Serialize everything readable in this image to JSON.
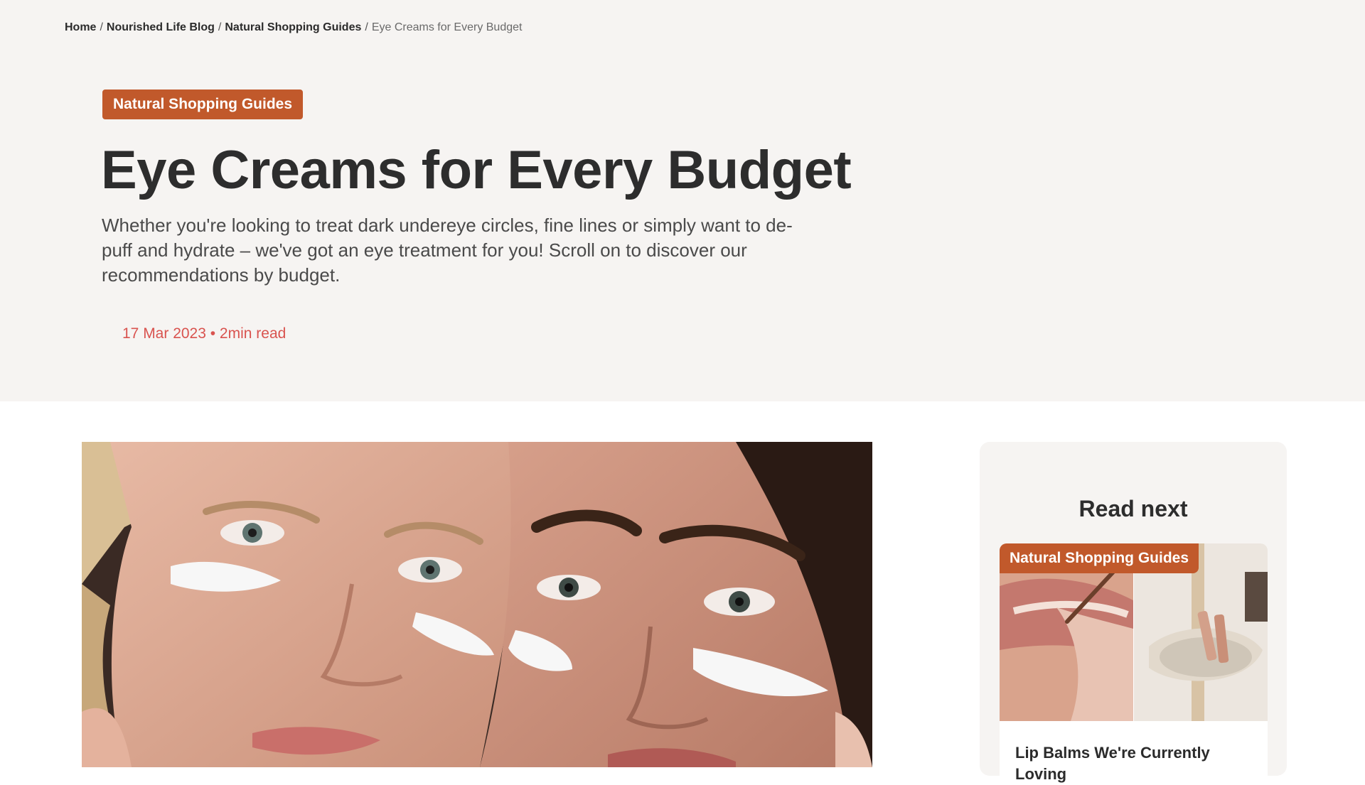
{
  "breadcrumb": {
    "home": "Home",
    "blog": "Nourished Life Blog",
    "category": "Natural Shopping Guides",
    "current": "Eye Creams for Every Budget",
    "separator": "/"
  },
  "article": {
    "category": "Natural Shopping Guides",
    "title": "Eye Creams for Every Budget",
    "intro": "Whether you're looking to treat dark undereye circles, fine lines or simply want to de-puff and hydrate – we've got an eye treatment for you! Scroll on to discover our recommendations by budget.",
    "meta": "17 Mar 2023 • 2min read"
  },
  "sidebar": {
    "heading": "Read next",
    "card": {
      "category": "Natural Shopping Guides",
      "title": "Lip Balms We're Currently Loving"
    }
  },
  "colors": {
    "accent": "#c1592b",
    "meta_text": "#d9534f",
    "hero_background": "#f6f4f2"
  }
}
